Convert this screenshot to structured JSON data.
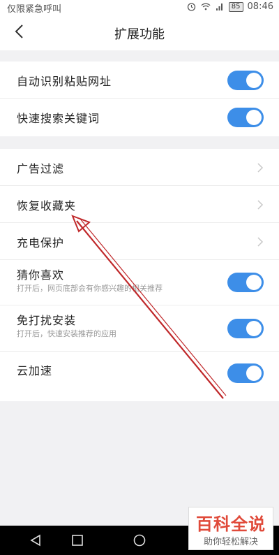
{
  "status_bar": {
    "carrier": "仅限紧急呼叫",
    "battery": "85",
    "time": "08:46"
  },
  "header": {
    "title": "扩展功能"
  },
  "group1": {
    "items": [
      {
        "label": "自动识别粘贴网址",
        "toggle_on": true
      },
      {
        "label": "快速搜索关键词",
        "toggle_on": true
      }
    ]
  },
  "group2": {
    "items": [
      {
        "label": "广告过滤"
      },
      {
        "label": "恢复收藏夹"
      },
      {
        "label": "充电保护"
      },
      {
        "label": "猜你喜欢",
        "subtitle": "打开后，网页底部会有你感兴趣的相关推荐",
        "toggle_on": true
      },
      {
        "label": "免打扰安装",
        "subtitle": "打开后，快速安装推荐的应用",
        "toggle_on": true
      },
      {
        "label": "云加速",
        "toggle_on": true
      }
    ]
  },
  "watermark": {
    "title": "百科全说",
    "subtitle": "助你轻松解决"
  },
  "colors": {
    "accent": "#3d8ee8",
    "annotation": "#c0282a"
  }
}
